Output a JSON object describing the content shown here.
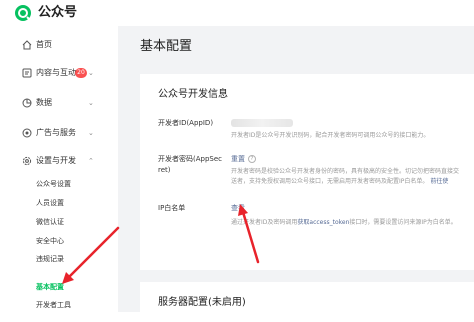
{
  "header": {
    "app_title": "公众号",
    "logo_icon": "wechat-official-account-logo"
  },
  "sidebar": {
    "items": [
      {
        "label": "首页",
        "icon": "home-icon"
      },
      {
        "label": "内容与互动",
        "icon": "content-icon",
        "badge": "20",
        "chevron": "⌄"
      },
      {
        "label": "数据",
        "icon": "data-icon",
        "chevron": "⌄"
      },
      {
        "label": "广告与服务",
        "icon": "ad-icon",
        "chevron": "⌄"
      },
      {
        "label": "设置与开发",
        "icon": "settings-icon",
        "chevron": "⌃"
      }
    ],
    "sub_items": [
      {
        "label": "公众号设置"
      },
      {
        "label": "人员设置"
      },
      {
        "label": "微信认证"
      },
      {
        "label": "安全中心"
      },
      {
        "label": "违规记录"
      },
      {
        "label": "基本配置",
        "active": true
      },
      {
        "label": "开发者工具"
      }
    ]
  },
  "main": {
    "page_title": "基本配置",
    "dev_info": {
      "title": "公众号开发信息",
      "appid": {
        "label": "开发者ID(AppID)",
        "desc": "开发者ID是公众号开发识别码，配合开发者密码可调用公众号的接口能力。"
      },
      "secret": {
        "label_line1": "开发者密码(AppSec",
        "label_line2": "ret)",
        "action": "重置",
        "help": "?",
        "desc_line1": "开发者密码是校验公众号开发者身份的密码，具有极高的安全性。切记勿把密码直接交",
        "desc_line2": "送者，支持免授权调用公众号接口，无需启用开发者密码及配置IP白名单。",
        "more": "前往使"
      },
      "whitelist": {
        "label": "IP白名单",
        "action": "查看",
        "desc_prefix": "通过开发者ID及密码调用",
        "desc_link": "获取access_token",
        "desc_suffix": "接口时，需要设置访问来源IP为白名单。"
      }
    },
    "server_config": {
      "title": "服务器配置(未启用)"
    }
  },
  "colors": {
    "accent": "#07c160",
    "link": "#576b95",
    "annotation_arrow": "#e8232b"
  }
}
